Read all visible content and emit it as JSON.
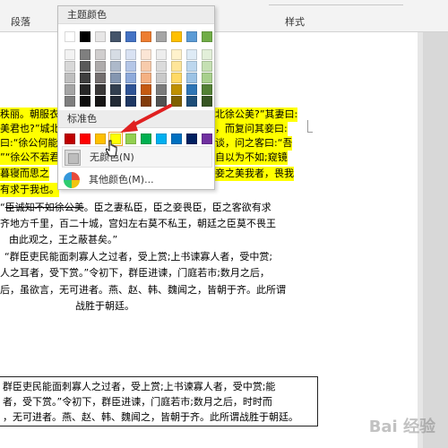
{
  "ribbon": {
    "paragraph_label": "段落",
    "styles_label": "样式"
  },
  "dropdown": {
    "theme_heading": "主题颜色",
    "standard_heading": "标准色",
    "no_color_label": "无颜色(N)",
    "more_colors_label": "其他颜色(M)...",
    "theme_top_row": [
      "#ffffff",
      "#000000",
      "#e7e6e6",
      "#44546a",
      "#4472c4",
      "#ed7d31",
      "#a5a5a5",
      "#ffc000",
      "#5b9bd5",
      "#70ad47"
    ],
    "theme_shades": [
      [
        "#f2f2f2",
        "#7f7f7f",
        "#d0cece",
        "#d6dce4",
        "#d9e2f3",
        "#fbe5d5",
        "#ededed",
        "#fff2cc",
        "#deebf6",
        "#e2efd9"
      ],
      [
        "#d8d8d8",
        "#595959",
        "#aeabab",
        "#adb9ca",
        "#b4c6e7",
        "#f7cbac",
        "#dbdbdb",
        "#fee599",
        "#bdd7ee",
        "#c5e0b3"
      ],
      [
        "#bfbfbf",
        "#3f3f3f",
        "#757070",
        "#8496b0",
        "#8eaadb",
        "#f4b183",
        "#c9c9c9",
        "#ffd965",
        "#9cc3e5",
        "#a8d08d"
      ],
      [
        "#a5a5a5",
        "#262626",
        "#3a3838",
        "#323f4f",
        "#2f5496",
        "#c55a11",
        "#7b7b7b",
        "#bf9000",
        "#2e75b5",
        "#538135"
      ],
      [
        "#7f7f7f",
        "#0c0c0c",
        "#171616",
        "#222a35",
        "#1f3864",
        "#833c0b",
        "#525252",
        "#7f6000",
        "#1e4e79",
        "#375623"
      ]
    ],
    "standard_colors": [
      "#c00000",
      "#ff0000",
      "#ffc000",
      "#ffff00",
      "#92d050",
      "#00b050",
      "#00b0f0",
      "#0070c0",
      "#002060",
      "#7030a0"
    ],
    "selected_standard_index": 3
  },
  "document": {
    "highlight_lines_left": [
      "秩丽。朝服衣",
      "美君也?”城北",
      "曰:“徐公何能",
      "”“徐公不若君",
      "暮寝而思之",
      "有求于我也。"
    ],
    "highlight_lines_right": [
      "北徐公美?”其妻曰:",
      "，而复问其妾曰:",
      "谈，问之客曰:“吾",
      "自以为不如;窥镜",
      "妾之美我者，畏我",
      ""
    ],
    "body_lines": [
      "臣诚知不如徐公美。臣之妻私臣，臣之妾畏臣，臣之客欲有求",
      "齐地方千里，百二十城，宫妇左右莫不私王，朝廷之臣莫不畏王",
      "由此观之，王之蔽甚矣。”",
      "“群臣吏民能面刺寡人之过者，受上赏;上书谏寡人者，受中赏;",
      "人之耳者，受下赏。”令初下，群臣进谏，门庭若市;数月之后，",
      "后，虽欲言，无可进者。燕、赵、韩、魏闻之，皆朝于齐。此所谓",
      "战胜于朝廷。"
    ],
    "box_lines": [
      "群臣吏民能面刺寡人之过者，受上赏;上书谏寡人者，受中赏;能",
      "者，受下赏。”令初下，群臣进谏，门庭若市;数月之后，时时而",
      "，无可进者。燕、赵、韩、魏闻之，皆朝于齐。此所谓战胜于朝廷。"
    ],
    "strike_prefix": "臣诚知不如徐公美",
    "watermark": "Bai 经验"
  }
}
